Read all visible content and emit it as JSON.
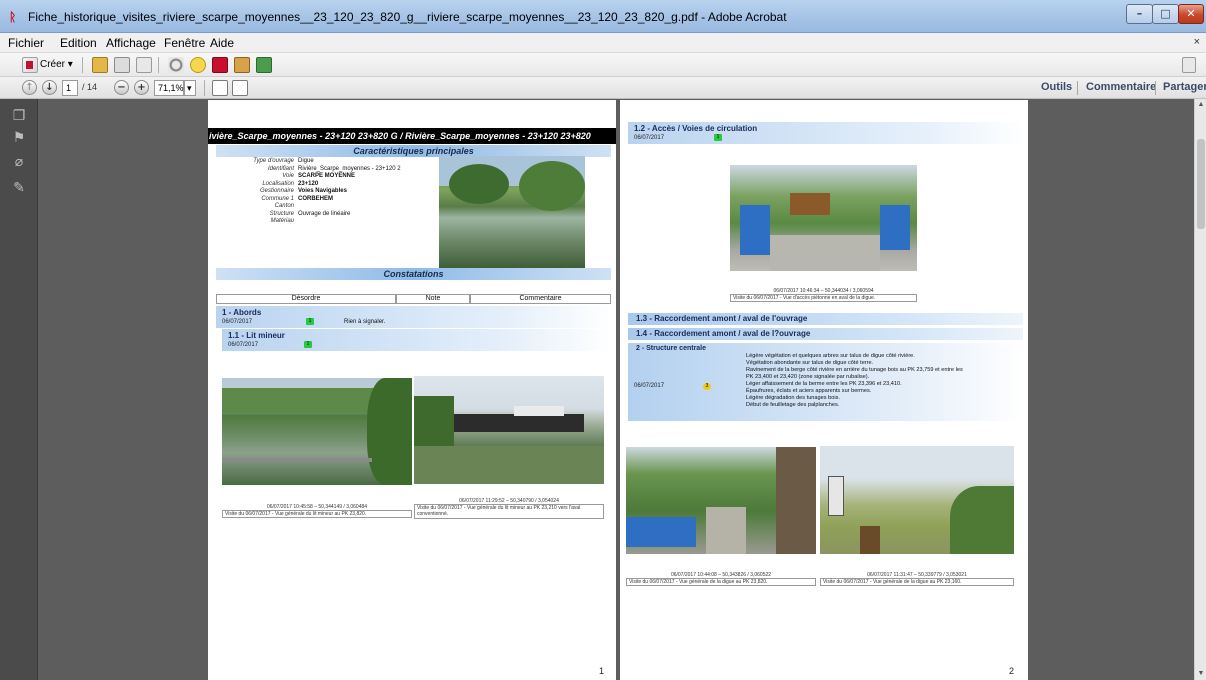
{
  "window": {
    "title": "Fiche_historique_visites_riviere_scarpe_moyennes__23_120_23_820_g__riviere_scarpe_moyennes__23_120_23_820_g.pdf - Adobe Acrobat",
    "min": "–",
    "max": "□",
    "close": "✕"
  },
  "menu": {
    "items": [
      "Fichier",
      "Edition",
      "Affichage",
      "Fenêtre",
      "Aide"
    ],
    "close_doc": "×"
  },
  "toolbar": {
    "create_label": "Créer ▾",
    "page_current": "1",
    "page_total": "/ 14",
    "zoom": "71,1%",
    "zoom_dropdown": "▾",
    "outils": "Outils",
    "commentaire": "Commentaire",
    "partager": "Partager"
  },
  "page1": {
    "banner": "ivière_Scarpe_moyennes - 23+120 23+820 G / Rivière_Scarpe_moyennes - 23+120 23+820",
    "section_main": "Caractéristiques principales",
    "fields": [
      {
        "k": "Type d'ouvrage",
        "v": "Digue"
      },
      {
        "k": "Identifiant",
        "v": "Rivière_Scarpe_moyennes - 23+120 2"
      },
      {
        "k": "Voie",
        "v": "SCARPE MOYENNE"
      },
      {
        "k": "Localisation",
        "v": "23+120"
      },
      {
        "k": "Gestionnaire",
        "v": "Voies Navigables"
      },
      {
        "k": "Commune 1",
        "v": "CORBEHEM"
      },
      {
        "k": "Canton",
        "v": ""
      },
      {
        "k": "Structure",
        "v": "Ouvrage de linéaire"
      },
      {
        "k": "Matériau",
        "v": ""
      }
    ],
    "section_constat": "Constatations",
    "table_headers": [
      "Désordre",
      "Note",
      "Commentaire"
    ],
    "abords": {
      "title": "1 - Abords",
      "date": "06/07/2017",
      "note": "1",
      "comment": "Rien à signaler."
    },
    "lit": {
      "title": "1.1 - Lit mineur",
      "date": "06/07/2017",
      "note": "1"
    },
    "photo1": {
      "caption": "06/07/2017 10:45:58 – 50,344149 / 3,060484",
      "desc": "Visite du 06/07/2017 - Vue générale du lit mineur au PK 23,820."
    },
    "photo2": {
      "caption": "06/07/2017 11:29:52 – 50,340790 / 3,054024",
      "desc": "Visite du 06/07/2017 - Vue générale du lit mineur au PK 23,210 vers l'aval",
      "desc2": "conventionné."
    },
    "page_number": "1"
  },
  "page2": {
    "acces": {
      "title": "1.2 - Accès / Voies de circulation",
      "date": "06/07/2017",
      "note": "1"
    },
    "photo_acces": {
      "caption": "06/07/2017 10:46:34 – 50,344034 / 3,060594",
      "desc": "Visite du 06/07/2017 - Vue d'accès piétonne en aval de la digue."
    },
    "r13": "1.3 - Raccordement amont / aval de l'ouvrage",
    "r14": "1.4 - Raccordement amont / aval de l?ouvrage",
    "structure": {
      "title": "2 - Structure centrale",
      "date": "06/07/2017",
      "note": "3",
      "lines": [
        "Légère végétation et quelques arbres sur talus de digue côté rivière.",
        "Végétation abondante sur talus de digue côté terre.",
        "Ravinement de la berge côté rivière en arrière du tunage bois au PK 23,759 et entre les",
        "PK 23,400 et 23,420 (zone signalée par rubalise).",
        "Léger affaissement de la berme entre les PK 23,396 et 23,410.",
        "Épaufrures, éclats et aciers apparents sur bermes.",
        "Légère dégradation des tunages bois.",
        "Début de feuilletage des palplanches."
      ]
    },
    "photo3": {
      "caption": "06/07/2017 10:44:08 – 50,343826 / 3,060522",
      "desc": "Visite du 06/07/2017 - Vue générale de la digue au PK 23,820."
    },
    "photo4": {
      "caption": "06/07/2017 11:31:47 – 50,339779 / 3,053021",
      "desc": "Visite du 06/07/2017 - Vue générale de la digue au PK 23,160."
    },
    "page_number": "2"
  }
}
